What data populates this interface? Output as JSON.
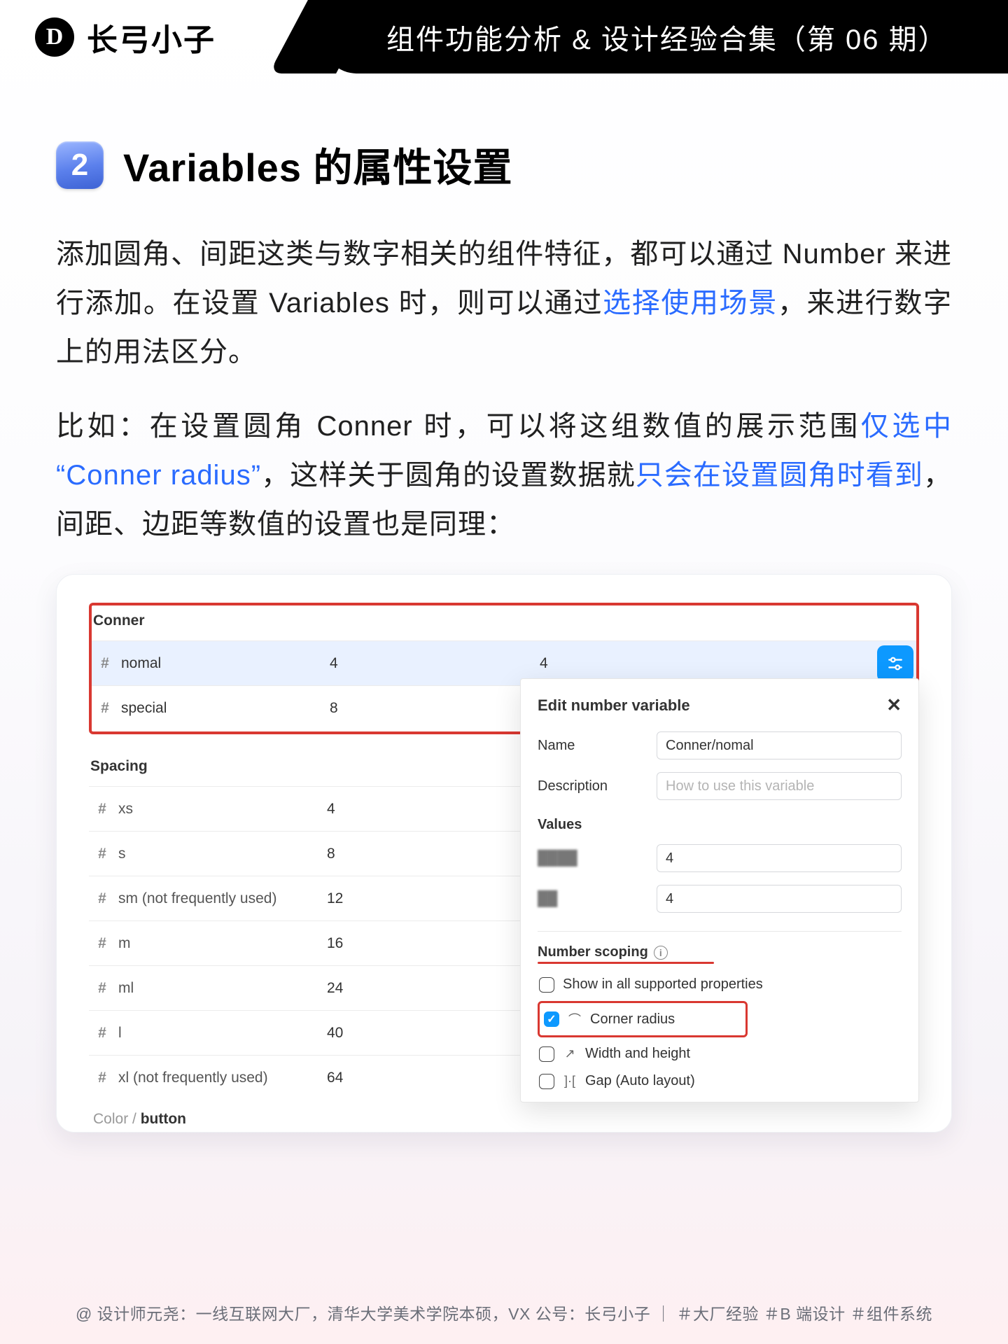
{
  "header": {
    "brand": "长弓小子",
    "logo_char": "D",
    "title": "组件功能分析 & 设计经验合集（第 06 期）"
  },
  "section": {
    "badge": "2",
    "heading": "Variables 的属性设置",
    "p1_a": "添加圆角、间距这类与数字相关的组件特征，都可以通过 Number 来进行添加。在设置 Variables 时，则可以通过",
    "p1_hl": "选择使用场景",
    "p1_b": "，来进行数字上的用法区分。",
    "p2_a": "比如：在设置圆角 Conner 时，可以将这组数值的展示范围",
    "p2_hl1": "仅选中 “Conner radius”",
    "p2_b": "，这样关于圆角的设置数据就",
    "p2_hl2": "只会在设置圆角时看到",
    "p2_c": "，间距、边距等数值的设置也是同理："
  },
  "figure": {
    "groups": {
      "conner": {
        "title": "Conner",
        "rows": [
          {
            "name": "nomal",
            "v1": "4",
            "v2": "4",
            "selected": true
          },
          {
            "name": "special",
            "v1": "8",
            "v2": ""
          }
        ]
      },
      "spacing": {
        "title": "Spacing",
        "rows": [
          {
            "name": "xs",
            "v1": "4"
          },
          {
            "name": "s",
            "v1": "8"
          },
          {
            "name": "sm (not frequently used)",
            "v1": "12"
          },
          {
            "name": "m",
            "v1": "16"
          },
          {
            "name": "ml",
            "v1": "24"
          },
          {
            "name": "l",
            "v1": "40"
          },
          {
            "name": "xl (not frequently used)",
            "v1": "64"
          }
        ]
      }
    },
    "footer_path_a": "Color / ",
    "footer_path_b": "button",
    "popover": {
      "title": "Edit number variable",
      "name_label": "Name",
      "name_value": "Conner/nomal",
      "desc_label": "Description",
      "desc_placeholder": "How to use this variable",
      "values_label": "Values",
      "values": [
        {
          "v": "4"
        },
        {
          "v": "4"
        }
      ],
      "scoping_label": "Number scoping",
      "scope_opts": [
        {
          "label": "Show in all supported properties",
          "checked": false,
          "icon": ""
        },
        {
          "label": "Corner radius",
          "checked": true,
          "icon": "⌒"
        },
        {
          "label": "Width and height",
          "checked": false,
          "icon": "↗"
        },
        {
          "label": "Gap (Auto layout)",
          "checked": false,
          "icon": "]·["
        }
      ]
    }
  },
  "footer": "@ 设计师元尧：一线互联网大厂，清华大学美术学院本硕，VX 公号：长弓小子 ｜ ＃大厂经验  ＃B 端设计  ＃组件系统"
}
